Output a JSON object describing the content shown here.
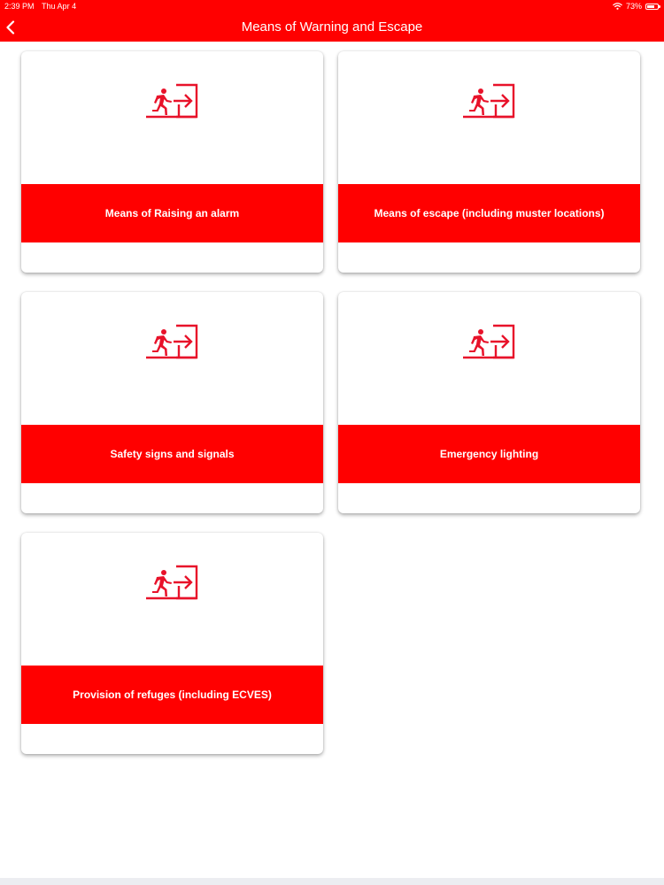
{
  "status_bar": {
    "time": "2:39 PM",
    "date": "Thu Apr 4",
    "battery_percent": "73%",
    "battery_level": 0.73,
    "wifi_icon": "wifi-icon",
    "battery_icon": "battery-icon"
  },
  "header": {
    "title": "Means of Warning and Escape",
    "back_icon": "chevron-left-icon"
  },
  "colors": {
    "accent": "#ff0000",
    "card_background": "#ffffff",
    "page_background": "#ffffff"
  },
  "cards": [
    {
      "label": "Means of Raising an alarm",
      "icon": "emergency-exit-icon"
    },
    {
      "label": "Means of escape (including muster locations)",
      "icon": "emergency-exit-icon"
    },
    {
      "label": "Safety signs and signals",
      "icon": "emergency-exit-icon"
    },
    {
      "label": "Emergency lighting",
      "icon": "emergency-exit-icon"
    },
    {
      "label": "Provision of refuges (including ECVES)",
      "icon": "emergency-exit-icon"
    }
  ]
}
